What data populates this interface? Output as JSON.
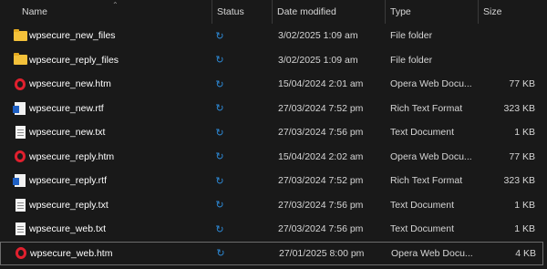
{
  "columns": {
    "name": "Name",
    "status": "Status",
    "date": "Date modified",
    "type": "Type",
    "size": "Size"
  },
  "files": [
    {
      "name": "wpsecure_new_files",
      "icon": "folder-icon",
      "date": "3/02/2025 1:09 am",
      "type": "File folder",
      "size": ""
    },
    {
      "name": "wpsecure_reply_files",
      "icon": "folder-icon",
      "date": "3/02/2025 1:09 am",
      "type": "File folder",
      "size": ""
    },
    {
      "name": "wpsecure_new.htm",
      "icon": "opera-icon",
      "date": "15/04/2024 2:01 am",
      "type": "Opera Web Docu...",
      "size": "77 KB"
    },
    {
      "name": "wpsecure_new.rtf",
      "icon": "word-rtf-icon",
      "date": "27/03/2024 7:52 pm",
      "type": "Rich Text Format",
      "size": "323 KB"
    },
    {
      "name": "wpsecure_new.txt",
      "icon": "text-document-icon",
      "date": "27/03/2024 7:56 pm",
      "type": "Text Document",
      "size": "1 KB"
    },
    {
      "name": "wpsecure_reply.htm",
      "icon": "opera-icon",
      "date": "15/04/2024 2:02 am",
      "type": "Opera Web Docu...",
      "size": "77 KB"
    },
    {
      "name": "wpsecure_reply.rtf",
      "icon": "word-rtf-icon",
      "date": "27/03/2024 7:52 pm",
      "type": "Rich Text Format",
      "size": "323 KB"
    },
    {
      "name": "wpsecure_reply.txt",
      "icon": "text-document-icon",
      "date": "27/03/2024 7:56 pm",
      "type": "Text Document",
      "size": "1 KB"
    },
    {
      "name": "wpsecure_web.txt",
      "icon": "text-document-icon",
      "date": "27/03/2024 7:56 pm",
      "type": "Text Document",
      "size": "1 KB"
    },
    {
      "name": "wpsecure_web.htm",
      "icon": "opera-icon",
      "date": "27/01/2025 8:00 pm",
      "type": "Opera Web Docu...",
      "size": "4 KB"
    }
  ],
  "status_icon": "sync-icon",
  "colors": {
    "background": "#191919",
    "folder": "#f3c13a",
    "opera": "#e0202e",
    "sync": "#2d8bd9",
    "rtf": "#1e5fc2"
  }
}
